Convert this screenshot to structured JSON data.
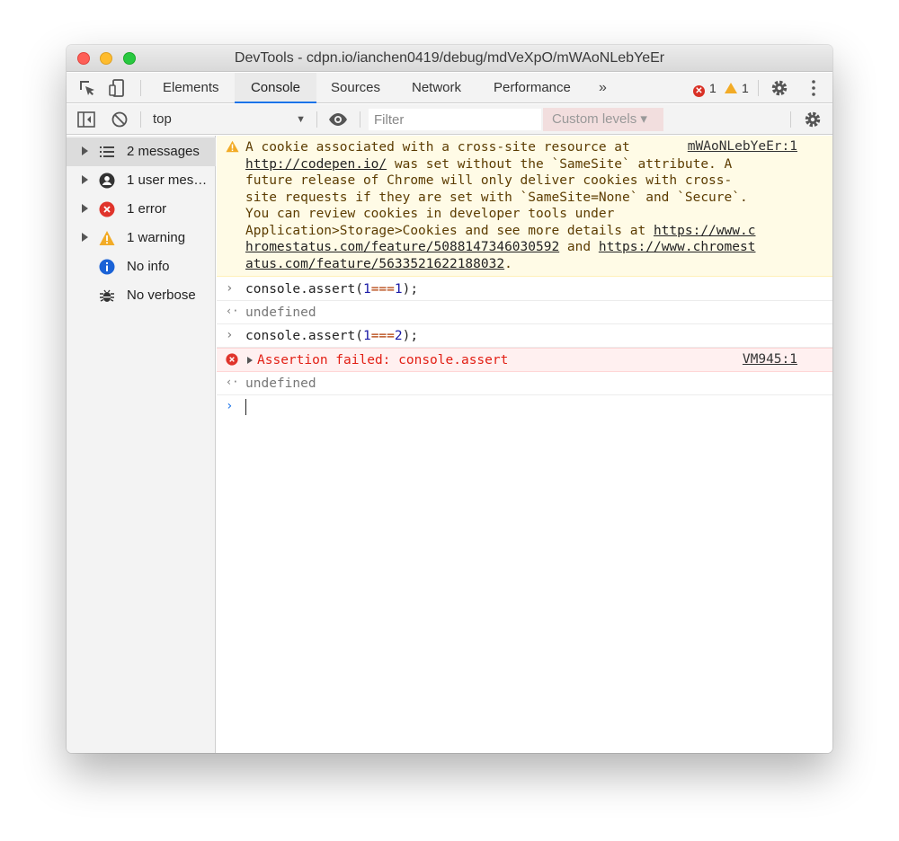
{
  "window": {
    "title": "DevTools - cdpn.io/ianchen0419/debug/mdVeXpO/mWAoNLebYeEr"
  },
  "tabs": [
    {
      "label": "Elements"
    },
    {
      "label": "Console"
    },
    {
      "label": "Sources"
    },
    {
      "label": "Network"
    },
    {
      "label": "Performance"
    }
  ],
  "tabbar": {
    "more": "»",
    "error_count": "1",
    "warning_count": "1"
  },
  "toolbar": {
    "context": "top",
    "filter_placeholder": "Filter",
    "levels": "Custom levels ▾"
  },
  "sidebar": {
    "items": [
      {
        "label": "2 messages",
        "icon": "list-icon"
      },
      {
        "label": "1 user mes…",
        "icon": "user-icon"
      },
      {
        "label": "1 error",
        "icon": "error-icon"
      },
      {
        "label": "1 warning",
        "icon": "warning-icon"
      },
      {
        "label": "No info",
        "icon": "info-icon"
      },
      {
        "label": "No verbose",
        "icon": "bug-icon"
      }
    ]
  },
  "console": {
    "warning": {
      "source": "mWAoNLebYeEr:1",
      "lines": [
        "A cookie associated with a cross-site resource at ",
        "http://codepen.io/",
        " was set without the `SameSite` attribute. A",
        "future release of Chrome will only deliver cookies with cross-",
        "site requests if they are set with `SameSite=None` and `Secure`.",
        "You can review cookies in developer tools under",
        "Application>Storage>Cookies and see more details at ",
        "https://www.c",
        "hromestatus.com/feature/5088147346030592",
        " and ",
        "https://www.chromest",
        "atus.com/feature/5633521622188032",
        "."
      ]
    },
    "input1": {
      "prefix": "console.assert(",
      "a": "1",
      "op": "===",
      "b": "1",
      "suffix": ");"
    },
    "result1": "undefined",
    "input2": {
      "prefix": "console.assert(",
      "a": "1",
      "op": "===",
      "b": "2",
      "suffix": ");"
    },
    "error": {
      "text": "Assertion failed: console.assert",
      "source": "VM945:1"
    },
    "result2": "undefined"
  },
  "colors": {
    "accent": "#1a73e8",
    "error": "#e21f14",
    "warning_bg": "#fffbe6",
    "error_bg": "#fff0f0"
  }
}
